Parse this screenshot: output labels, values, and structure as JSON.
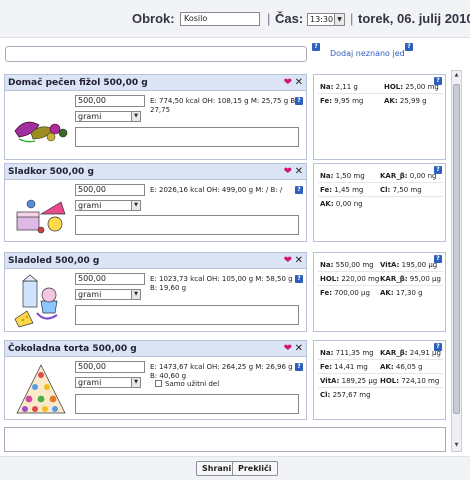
{
  "header": {
    "obrok_label": "Obrok:",
    "obrok_value": "Kosilo",
    "sep": "|",
    "cas_label": "Čas:",
    "cas_value": "13:30",
    "date": "torek, 06. julij 2010"
  },
  "search": {
    "placeholder": "",
    "add_link": "Dodaj neznano jed"
  },
  "help_glyph": "?",
  "foods": [
    {
      "title": "Domač pečen fižol 500,00 g",
      "qty": "500,00",
      "unit": "grami",
      "macros": "E: 774,50 kcal OH: 108,15 g M: 25,75 g B: 27,75",
      "nutrients": [
        {
          "name": "Na:",
          "value": "2,11 g"
        },
        {
          "name": "HOL:",
          "value": "25,00 mg"
        },
        {
          "name": "Fe:",
          "value": "9,95 mg"
        },
        {
          "name": "AK:",
          "value": "25,99 g"
        }
      ]
    },
    {
      "title": "Sladkor 500,00 g",
      "qty": "500,00",
      "unit": "grami",
      "macros": "E: 2026,16 kcal OH: 499,00 g M: / B: /",
      "nutrients": [
        {
          "name": "Na:",
          "value": "1,50 mg"
        },
        {
          "name": "KAR_β:",
          "value": "0,00 ng"
        },
        {
          "name": "Fe:",
          "value": "1,45 mg"
        },
        {
          "name": "Cl:",
          "value": "7,50 mg"
        },
        {
          "name": "AK:",
          "value": "0,00 ng"
        }
      ]
    },
    {
      "title": "Sladoled 500,00 g",
      "qty": "500,00",
      "unit": "grami",
      "macros": "E: 1023,73 kcal OH: 105,00 g M: 58,50 g B: 19,60 g",
      "nutrients": [
        {
          "name": "Na:",
          "value": "550,00 mg"
        },
        {
          "name": "VitA:",
          "value": "195,00 μg"
        },
        {
          "name": "HOL:",
          "value": "220,00 mg"
        },
        {
          "name": "KAR_β:",
          "value": "95,00 μg"
        },
        {
          "name": "Fe:",
          "value": "700,00 μg"
        },
        {
          "name": "AK:",
          "value": "17,30 g"
        }
      ]
    },
    {
      "title": "Čokoladna torta 500,00 g",
      "qty": "500,00",
      "unit": "grami",
      "macros": "E: 1473,67 kcal OH: 264,25 g M: 26,96 g B: 40,60 g",
      "checkbox_label": "Samo užitni del",
      "nutrients": [
        {
          "name": "Na:",
          "value": "711,35 mg"
        },
        {
          "name": "KAR_β:",
          "value": "24,91 μg"
        },
        {
          "name": "Fe:",
          "value": "14,41 mg"
        },
        {
          "name": "AK:",
          "value": "46,05 g"
        },
        {
          "name": "VitA:",
          "value": "189,25 μg"
        },
        {
          "name": "HOL:",
          "value": "724,10 mg"
        },
        {
          "name": "Cl:",
          "value": "257,67 mg"
        }
      ]
    }
  ],
  "buttons": {
    "save": "Shrani",
    "cancel": "Prekliči"
  },
  "icons": {
    "heart": "heart-icon",
    "close": "close-icon",
    "help": "help-icon"
  },
  "colors": {
    "card_header": "#dbe5f6",
    "heart": "#d0157a",
    "help": "#2d5fbf"
  }
}
